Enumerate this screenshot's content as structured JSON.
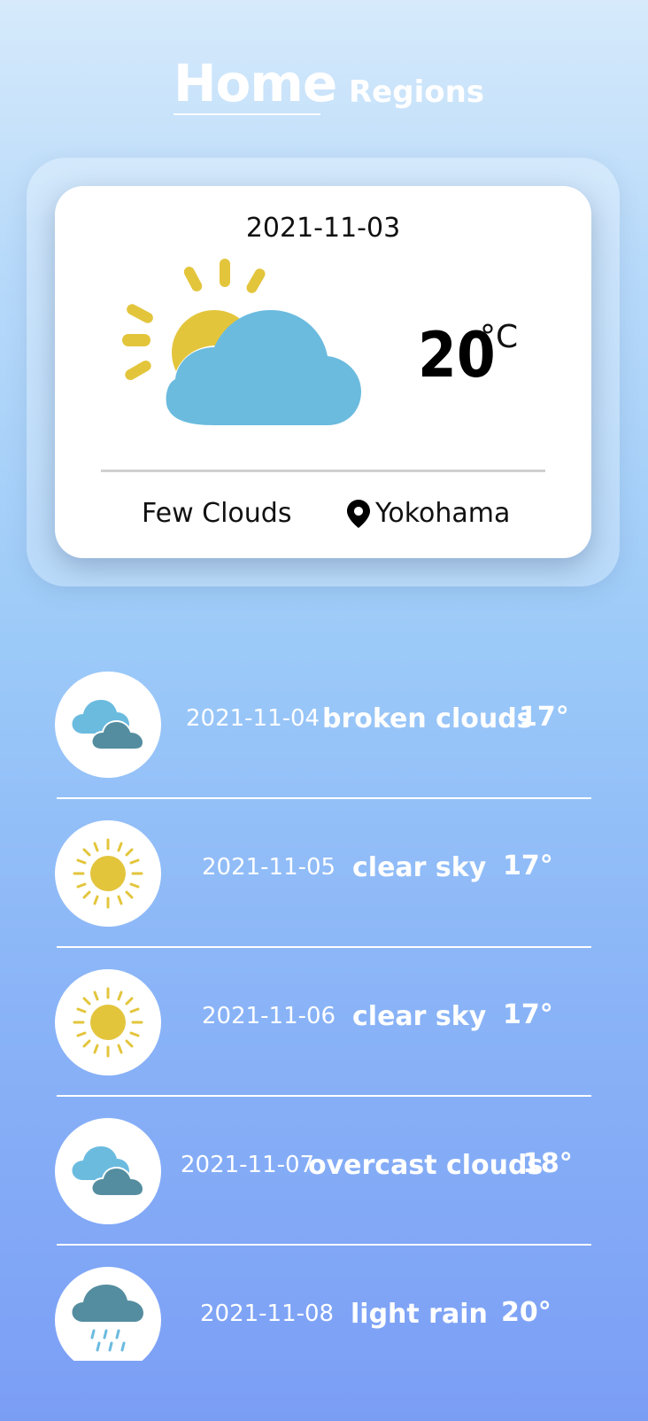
{
  "nav": {
    "home": "Home",
    "regions": "Regions"
  },
  "current": {
    "date": "2021-11-03",
    "temperature": "20",
    "unit": "°C",
    "description": "Few Clouds",
    "location": "Yokohama",
    "icon": "sun-cloud-icon"
  },
  "forecast": [
    {
      "date": "2021-11-04",
      "desc": "broken clouds",
      "temp": "17°",
      "icon": "broken-clouds-icon"
    },
    {
      "date": "2021-11-05",
      "desc": "clear sky",
      "temp": "17°",
      "icon": "sun-icon"
    },
    {
      "date": "2021-11-06",
      "desc": "clear sky",
      "temp": "17°",
      "icon": "sun-icon"
    },
    {
      "date": "2021-11-07",
      "desc": "overcast clouds",
      "temp": "18°",
      "icon": "overcast-clouds-icon"
    },
    {
      "date": "2021-11-08",
      "desc": "light rain",
      "temp": "20°",
      "icon": "rain-icon"
    }
  ],
  "colors": {
    "sun": "#e3c53c",
    "cloud_light": "#6bbbdf",
    "cloud_dark": "#548d9f",
    "rain": "#6bbbdf"
  }
}
